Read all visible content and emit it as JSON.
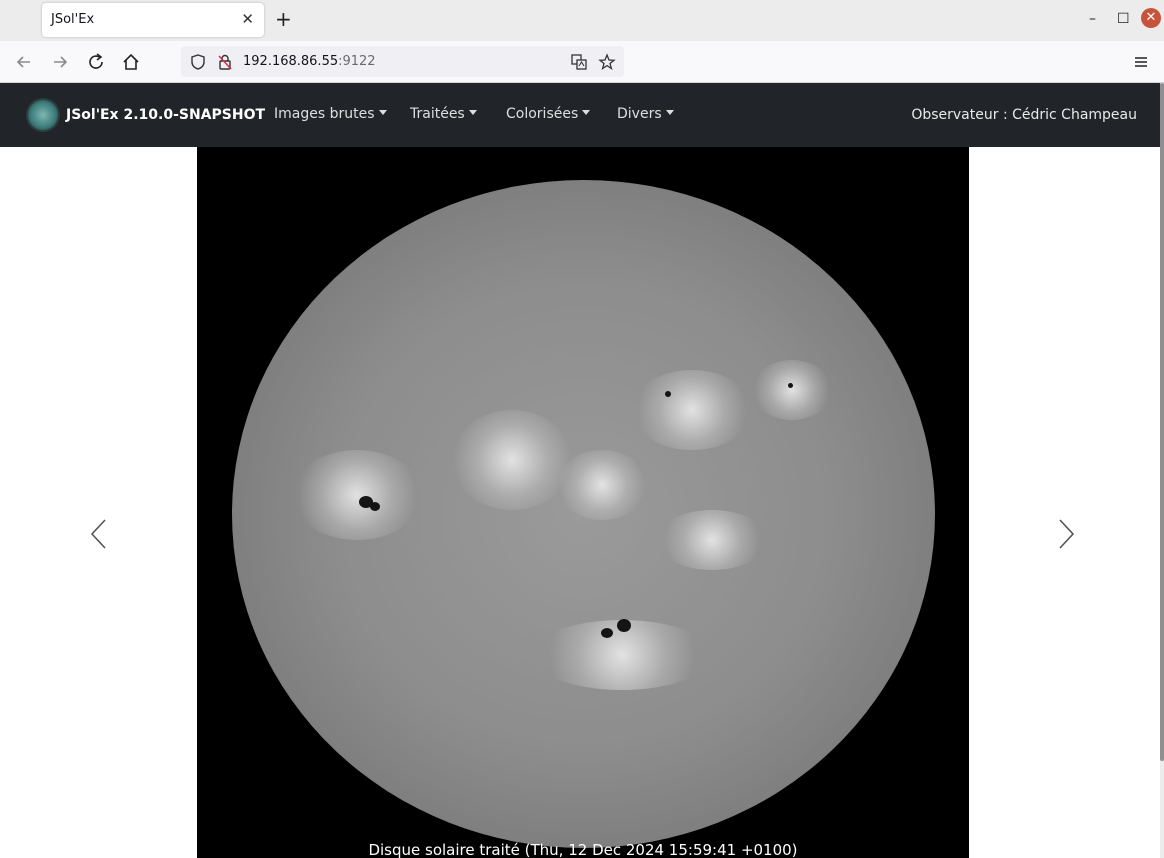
{
  "browser": {
    "tab_title": "JSol'Ex",
    "url_host": "192.168.86.55",
    "url_port": ":9122"
  },
  "app": {
    "brand": "JSol'Ex 2.10.0-SNAPSHOT",
    "menus": [
      {
        "label": "Images brutes"
      },
      {
        "label": "Traitées"
      },
      {
        "label": "Colorisées"
      },
      {
        "label": "Divers"
      }
    ],
    "observer": "Observateur : Cédric Champeau"
  },
  "carousel": {
    "caption": "Disque solaire traité (Thu, 12 Dec 2024 15:59:41 +0100)"
  },
  "colors": {
    "navbar_bg": "#212529",
    "slide_bg": "#000000"
  }
}
